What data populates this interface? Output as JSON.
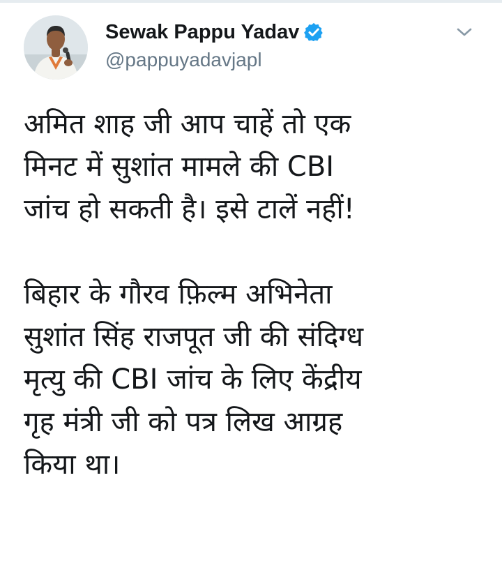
{
  "tweet": {
    "display_name": "Sewak Pappu Yadav",
    "handle": "@pappuyadavjapl",
    "verified": true,
    "icons": {
      "verified": "verified-badge-icon",
      "menu": "chevron-down-icon",
      "avatar": "profile-photo"
    },
    "colors": {
      "text": "#14171a",
      "secondary": "#657786",
      "accent": "#1da1f2"
    },
    "paragraphs": [
      "अमित शाह जी आप चाहें तो एक\nमिनट में सुशांत मामले की CBI\nजांच हो सकती है। इसे टालें नहीं!",
      "बिहार के गौरव फ़िल्म अभिनेता\nसुशांत सिंह राजपूत जी की संदिग्ध\nमृत्यु की CBI जांच के लिए केंद्रीय\nगृह मंत्री जी को पत्र लिख आग्रह\nकिया था।"
    ]
  }
}
